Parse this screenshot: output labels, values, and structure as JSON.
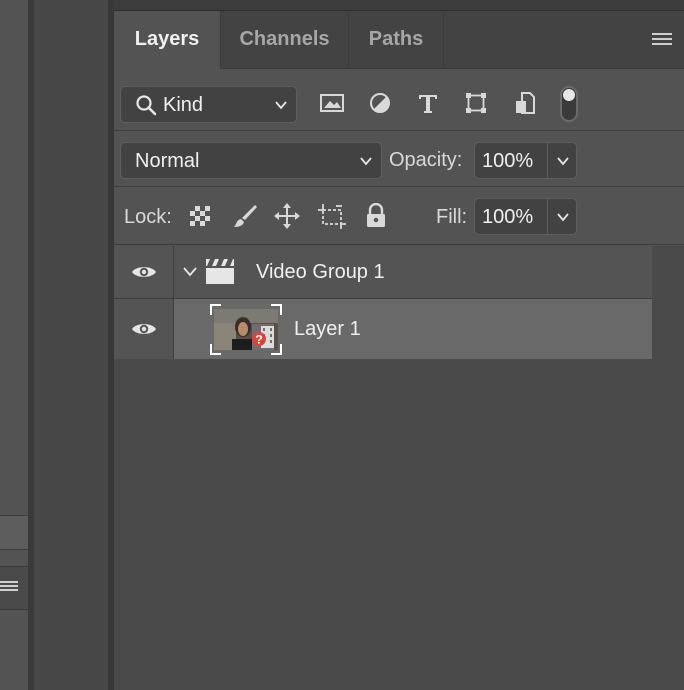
{
  "panel": {
    "tabs": [
      {
        "label": "Layers",
        "active": true
      },
      {
        "label": "Channels",
        "active": false
      },
      {
        "label": "Paths",
        "active": false
      }
    ],
    "menu_icon": "hamburger-icon"
  },
  "filter": {
    "kind_label": "Kind",
    "icons": [
      "image-filter-icon",
      "adjustment-filter-icon",
      "type-filter-icon",
      "shape-filter-icon",
      "smart-object-filter-icon"
    ]
  },
  "blend": {
    "mode": "Normal",
    "opacity_label": "Opacity:",
    "opacity_value": "100%"
  },
  "lock": {
    "label": "Lock:",
    "icons": [
      "lock-transparent-pixels-icon",
      "lock-image-pixels-icon",
      "lock-position-icon",
      "lock-artboard-icon",
      "lock-all-icon"
    ],
    "fill_label": "Fill:",
    "fill_value": "100%"
  },
  "layers": [
    {
      "name": "Video Group 1",
      "type": "video-group",
      "visible": true,
      "expanded": true
    },
    {
      "name": "Layer 1",
      "type": "video-layer",
      "visible": true,
      "selected": true
    }
  ],
  "colors": {
    "panel_bg": "#535353",
    "selected_row": "#696969",
    "missing_media_badge": "#d9453b"
  }
}
